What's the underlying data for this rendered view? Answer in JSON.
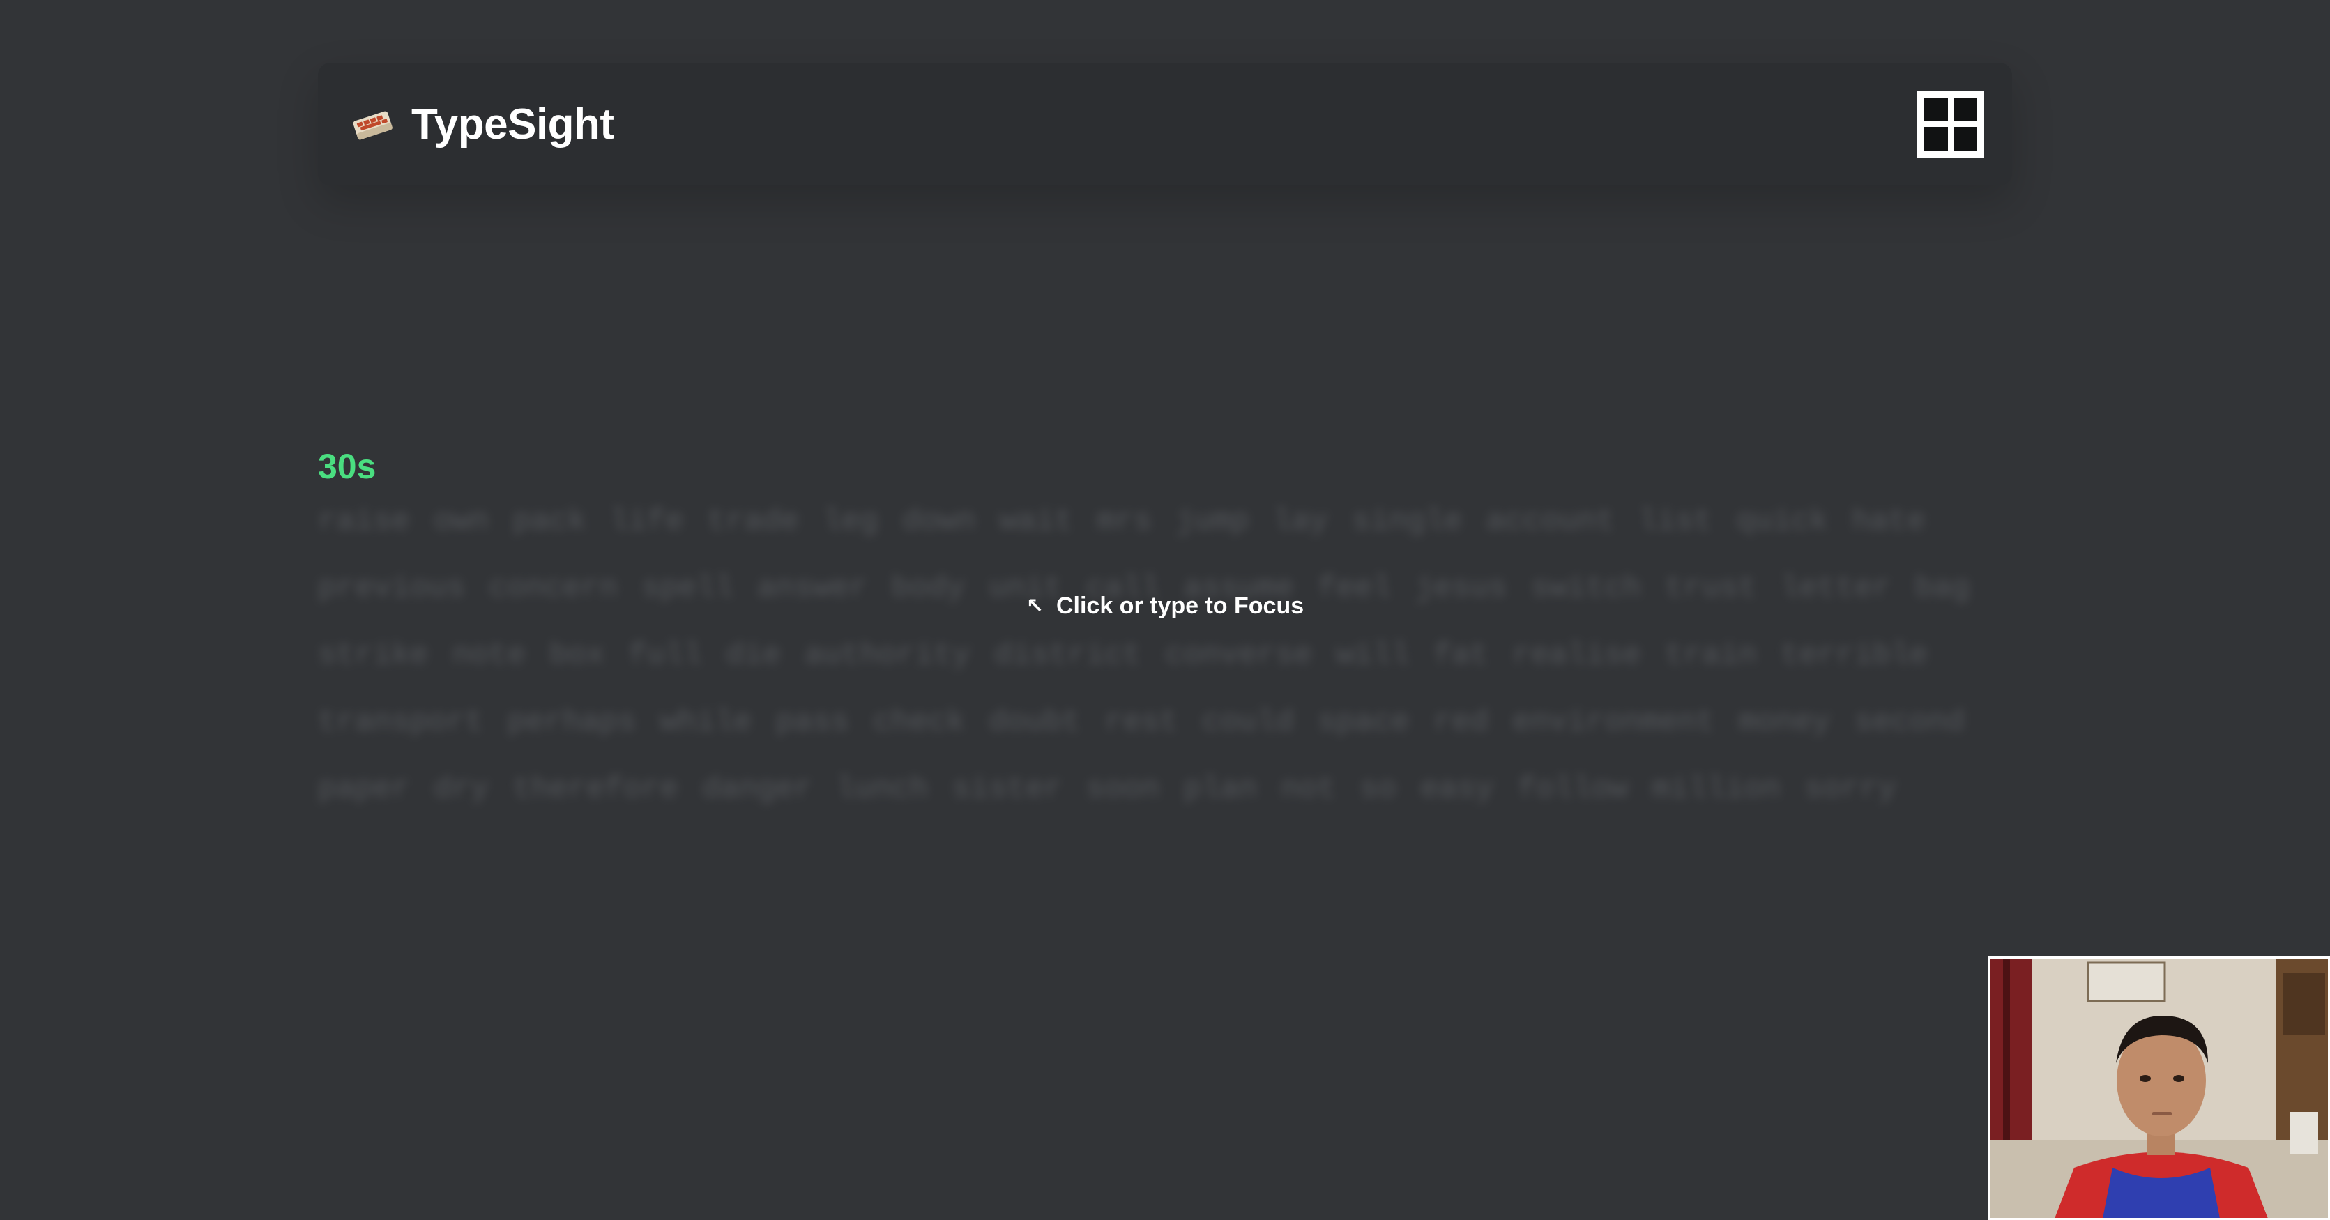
{
  "app": {
    "name": "TypeSight"
  },
  "header": {
    "logo_icon": "keyboard-icon",
    "layout_icon": "layout-grid-icon"
  },
  "test": {
    "timer": "30s",
    "focus_prompt": "Click or type to Focus",
    "words": [
      "raise",
      "own",
      "pack",
      "life",
      "trade",
      "leg",
      "down",
      "wait",
      "mrs",
      "jump",
      "lay",
      "single",
      "account",
      "list",
      "quick",
      "hate",
      "previous",
      "concern",
      "spell",
      "answer",
      "body",
      "unit",
      "call",
      "assume",
      "feel",
      "jesus",
      "switch",
      "trust",
      "letter",
      "bag",
      "strike",
      "note",
      "box",
      "full",
      "die",
      "authority",
      "district",
      "converse",
      "will",
      "fat",
      "realise",
      "train",
      "terrible",
      "transport",
      "perhaps",
      "while",
      "pass",
      "check",
      "doubt",
      "rest",
      "could",
      "space",
      "red",
      "environment",
      "money",
      "second",
      "paper",
      "dry",
      "therefore",
      "danger",
      "lunch",
      "sister",
      "soon",
      "plan",
      "not",
      "so",
      "easy",
      "follow",
      "million",
      "sorry"
    ]
  },
  "colors": {
    "background": "#323437",
    "header_bg": "#2c2e31",
    "timer": "#4ade80",
    "text": "#ffffff"
  }
}
